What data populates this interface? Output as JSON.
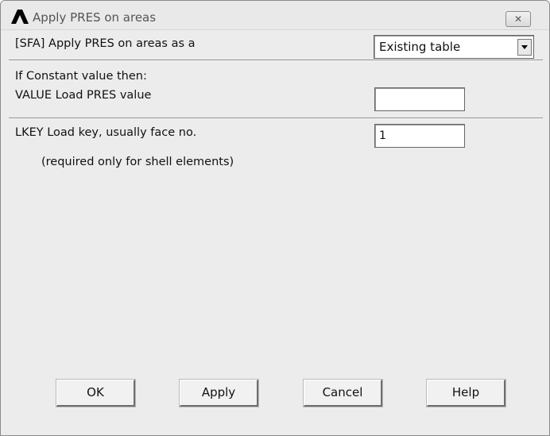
{
  "window": {
    "title": "Apply PRES on areas",
    "logo_icon": "ansys-logo-icon",
    "close_glyph": "✕"
  },
  "form": {
    "apply_as_label": "[SFA] Apply PRES on areas as a",
    "apply_as_value": "Existing table",
    "constant_heading": "If Constant value then:",
    "value_label": "VALUE  Load PRES value",
    "value_input": "",
    "lkey_label": "LKEY  Load key, usually face no.",
    "lkey_input": "1",
    "lkey_note": "(required only for shell elements)"
  },
  "buttons": {
    "ok": "OK",
    "apply": "Apply",
    "cancel": "Cancel",
    "help": "Help"
  }
}
